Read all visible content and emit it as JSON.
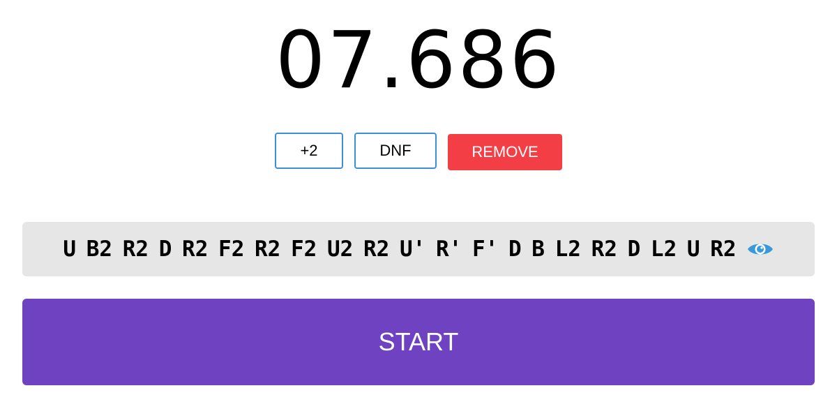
{
  "timer": {
    "display": "07.686"
  },
  "penalty": {
    "plus2_label": "+2",
    "dnf_label": "DNF",
    "remove_label": "REMOVE"
  },
  "scramble": {
    "text": "U B2 R2 D R2 F2 R2 F2 U2 R2 U' R' F' D B L2 R2 D L2 U R2",
    "toggle_icon": "eye-icon"
  },
  "start": {
    "label": "START"
  },
  "colors": {
    "accent_purple": "#6f42c1",
    "remove_red": "#f43e45",
    "outline_blue": "#3a8fd6",
    "scramble_bg": "#e6e6e6",
    "eye_blue": "#3a9ad9"
  }
}
